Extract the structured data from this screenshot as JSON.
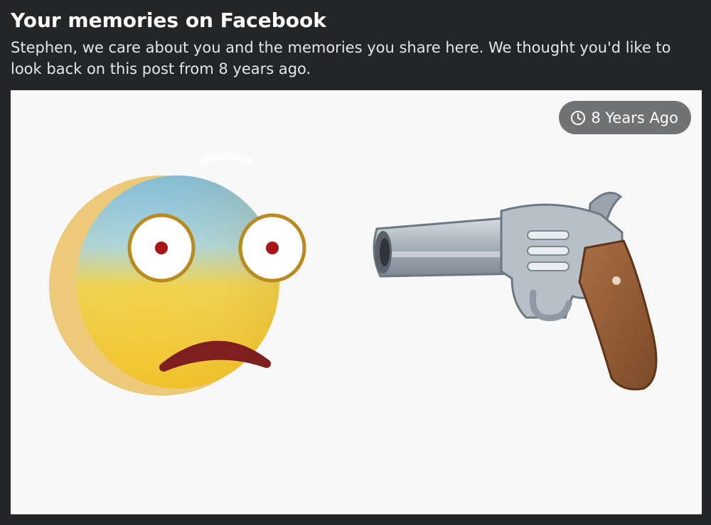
{
  "memory": {
    "title": "Your memories on Facebook",
    "message": "Stephen, we care about you and the memories you share here. We thought you'd like to look back on this post from 8 years ago.",
    "badge_label": "8 Years Ago",
    "badge_icon": "clock-icon",
    "image_icons": [
      "fearful-face-emoji",
      "pistol-emoji"
    ]
  },
  "colors": {
    "page_background": "#242526",
    "card_background": "#f8f8f8",
    "badge_background": "#646668"
  }
}
